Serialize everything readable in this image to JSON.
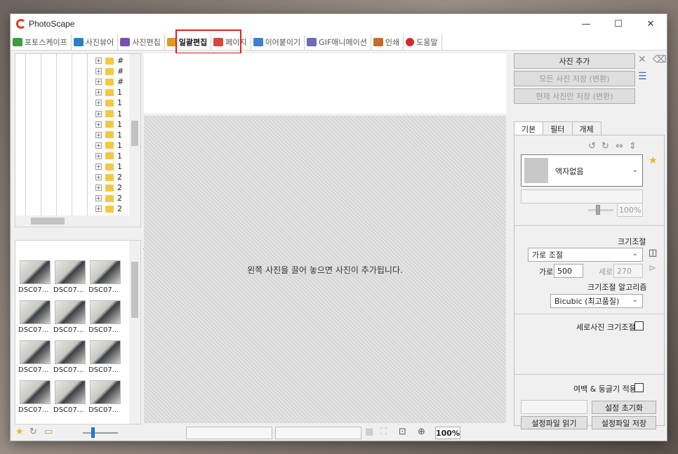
{
  "window": {
    "title": "PhotoScape",
    "controls": [
      "—",
      "☐",
      "✕"
    ]
  },
  "tabs": [
    {
      "label": "포토스케이프",
      "color": "#3a9e3a"
    },
    {
      "label": "사진뷰어",
      "color": "#2b7fc9"
    },
    {
      "label": "사진편집",
      "color": "#7a4fb0"
    },
    {
      "label": "일괄편집",
      "color": "#e09a1c",
      "active": true
    },
    {
      "label": "페이지",
      "color": "#d3483b"
    },
    {
      "label": "이어붙이기",
      "color": "#3a7fd0"
    },
    {
      "label": "GIF애니메이션",
      "color": "#6b6bb8"
    },
    {
      "label": "인쇄",
      "color": "#c86b2a"
    },
    {
      "label": "도움말",
      "color": "#d62b2b"
    }
  ],
  "tree": {
    "rows": [
      "#",
      "#",
      "#",
      "1",
      "1",
      "1",
      "1",
      "1",
      "1",
      "1",
      "1",
      "2",
      "2",
      "2",
      "2"
    ]
  },
  "thumbnails": {
    "rows": [
      [
        "DSC07...",
        "DSC07...",
        "DSC07..."
      ],
      [
        "DSC07...",
        "DSC07...",
        "DSC07..."
      ],
      [
        "DSC07...",
        "DSC07...",
        "DSC07..."
      ],
      [
        "DSC07...",
        "DSC07...",
        "DSC07..."
      ]
    ]
  },
  "canvas": {
    "message": "왼쪽 사진을 끌어 놓으면 사진이 추가됩니다."
  },
  "right_panel": {
    "add_photo": "사진 추가",
    "save_all": "모든 사진 저장 (변환)",
    "save_current": "현재 사진만 저장 (변환)",
    "tabs": [
      "기본",
      "필터",
      "개체"
    ],
    "frame": "액자없음",
    "frame_percent": "100%",
    "resize_title": "크기조절",
    "resize_mode": "가로 조절",
    "width_label": "가로",
    "width_value": "500",
    "height_label": "세로",
    "height_value": "270",
    "algo_label": "크기조절 알고리즘",
    "algo_value": "Bicubic (최고품질)",
    "vertical_resize": "세로사진 크기조절",
    "margin_round": "여백 & 둥글기 적용",
    "reset_settings": "설정 초기화",
    "load_settings": "설정파일 읽기",
    "save_settings": "설정파일 저장"
  },
  "statusbar": {
    "zoom": "100%"
  }
}
